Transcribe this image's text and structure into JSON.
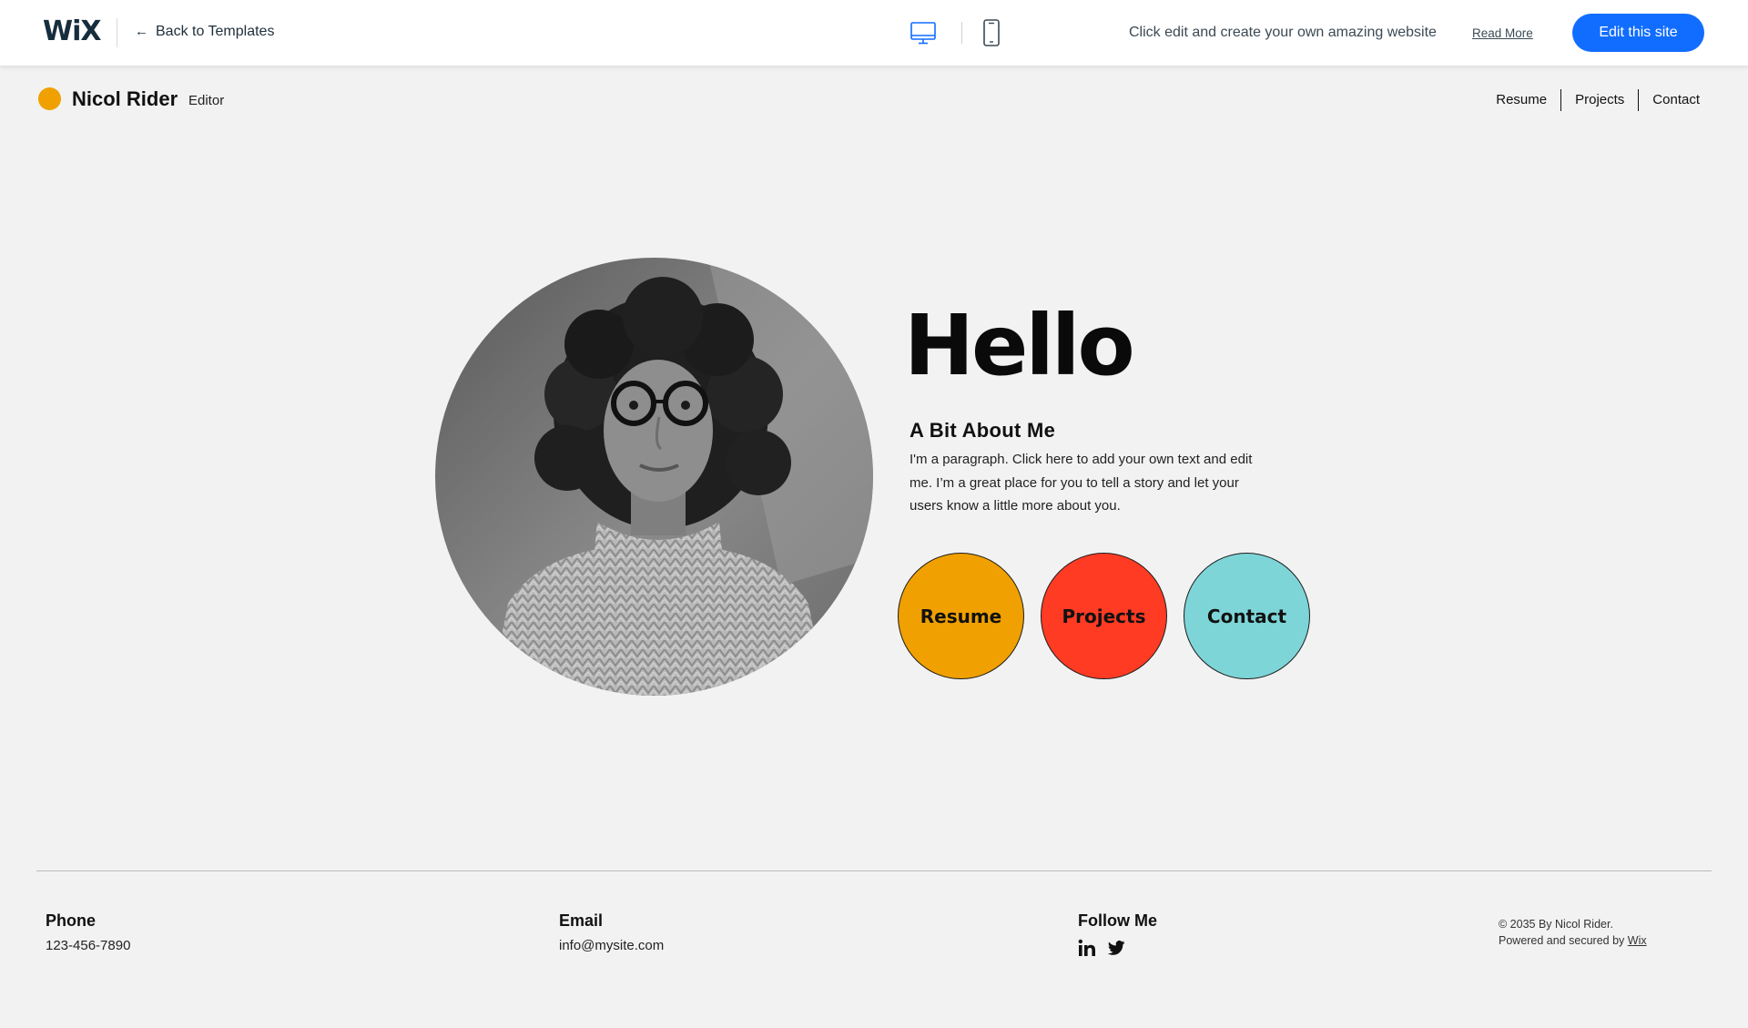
{
  "topbar": {
    "logo": "WiX",
    "back_label": "Back to Templates",
    "back_arrow": "←",
    "promo_text": "Click edit and create your own amazing website",
    "read_more": "Read More",
    "edit_button": "Edit this site",
    "accent_color": "#116dff"
  },
  "site": {
    "name": "Nicol Rider",
    "role": "Editor",
    "dot_color": "#f0a000",
    "nav": [
      "Resume",
      "Projects",
      "Contact"
    ]
  },
  "hero": {
    "heading": "Hello",
    "about_title": "A Bit About Me",
    "about_text": "I'm a paragraph. Click here to add your own text and edit me. I’m a great place for you to tell a story and let your users know a little more about you.",
    "buttons": [
      {
        "label": "Resume",
        "color": "#f0a000"
      },
      {
        "label": "Projects",
        "color": "#ff3b24"
      },
      {
        "label": "Contact",
        "color": "#7dd5d8"
      }
    ]
  },
  "footer": {
    "phone_heading": "Phone",
    "phone_value": "123-456-7890",
    "email_heading": "Email",
    "email_value": "info@mysite.com",
    "follow_heading": "Follow Me",
    "social_icons": [
      "linkedin-icon",
      "twitter-icon"
    ],
    "copyright_line1": "© 2035 By Nicol Rider.",
    "copyright_line2_prefix": "Powered and secured by ",
    "copyright_link": "Wix"
  }
}
